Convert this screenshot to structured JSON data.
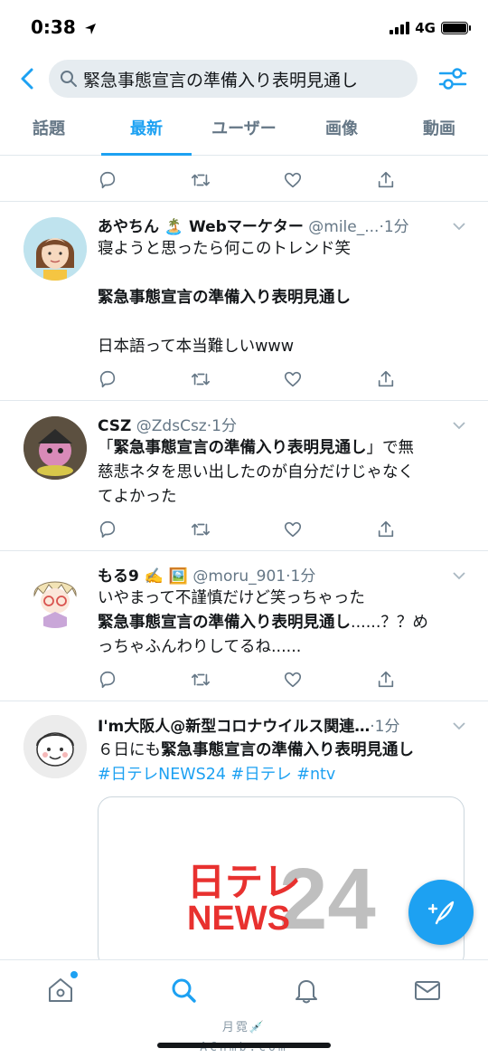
{
  "status": {
    "time": "0:38",
    "network": "4G"
  },
  "search": {
    "query": "緊急事態宣言の準備入り表明見通し"
  },
  "tabs": [
    {
      "label": "話題"
    },
    {
      "label": "最新"
    },
    {
      "label": "ユーザー"
    },
    {
      "label": "画像"
    },
    {
      "label": "動画"
    }
  ],
  "tweets": [
    {
      "name": "あやちん 🏝️ Webマーケター",
      "handle": "@mile_...",
      "time": "·1分",
      "line1": "寝ようと思ったら何このトレンド笑",
      "line2": "緊急事態宣言の準備入り表明見通し",
      "line3": "日本語って本当難しいwww"
    },
    {
      "name": "CSZ",
      "handle": "@ZdsCsz",
      "time": "·1分",
      "line1a": "「",
      "line1b": "緊急事態宣言の準備入り表明見通し",
      "line1c": "」で無",
      "line2": "慈悲ネタを思い出したのが自分だけじゃなく",
      "line3": "てよかった"
    },
    {
      "name": "もる9 ✍️ 🖼️",
      "handle": "@moru_901",
      "time": "·1分",
      "line1": "いやまって不謹慎だけど笑っちゃった",
      "line2a": "緊急事態宣言の準備入り表明見通し",
      "line2b": "......？？め",
      "line3": "っちゃふんわりしてるね......"
    },
    {
      "name": "I'm大阪人@新型コロナウイルス関連…",
      "handle": "",
      "time": "·1分",
      "line1a": "６日にも",
      "line1b": "緊急事態宣言の準備入り表明見通し",
      "hashtags": "#日テレNEWS24 #日テレ #ntv"
    }
  ],
  "card": {
    "logo_top": "日テレ",
    "logo_bottom": "NEWS",
    "logo_number": "24"
  },
  "watermark": {
    "line1": "月霓💉",
    "line2": "ACnmb.com"
  },
  "colors": {
    "accent": "#1da1f2",
    "text": "#14171a",
    "muted": "#657786",
    "news_red": "#e8312f",
    "news_grey": "#bfbfbf"
  }
}
